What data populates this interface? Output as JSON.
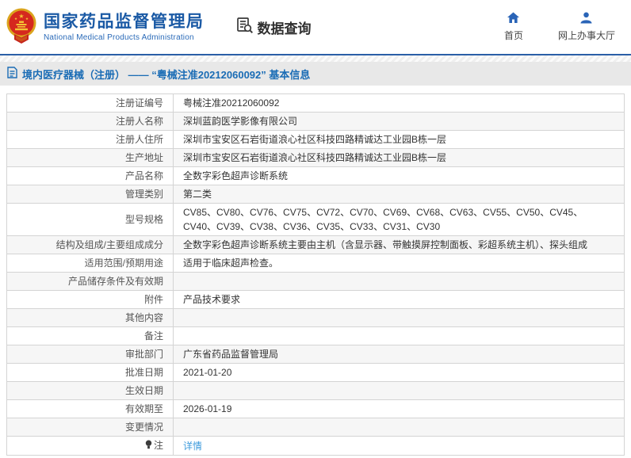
{
  "header": {
    "org_name_cn": "国家药品监督管理局",
    "org_name_en": "National Medical Products Administration",
    "data_query_label": "数据查询",
    "nav": [
      {
        "label": "首页",
        "icon": "home-icon"
      },
      {
        "label": "网上办事大厅",
        "icon": "person-icon"
      }
    ]
  },
  "breadcrumb": {
    "text": "境内医疗器械（注册） —— “粤械注准20212060092” 基本信息"
  },
  "table": {
    "rows": [
      {
        "label": "注册证编号",
        "value": "粤械注准20212060092"
      },
      {
        "label": "注册人名称",
        "value": "深圳蓝韵医学影像有限公司"
      },
      {
        "label": "注册人住所",
        "value": "深圳市宝安区石岩街道浪心社区科技四路精诚达工业园B栋一层"
      },
      {
        "label": "生产地址",
        "value": "深圳市宝安区石岩街道浪心社区科技四路精诚达工业园B栋一层"
      },
      {
        "label": "产品名称",
        "value": "全数字彩色超声诊断系统"
      },
      {
        "label": "管理类别",
        "value": "第二类"
      },
      {
        "label": "型号规格",
        "value": "CV85、CV80、CV76、CV75、CV72、CV70、CV69、CV68、CV63、CV55、CV50、CV45、CV40、CV39、CV38、CV36、CV35、CV33、CV31、CV30"
      },
      {
        "label": "结构及组成/主要组成成分",
        "value": "全数字彩色超声诊断系统主要由主机（含显示器、带触摸屏控制面板、彩超系统主机）、探头组成"
      },
      {
        "label": "适用范围/预期用途",
        "value": "适用于临床超声检查。"
      },
      {
        "label": "产品储存条件及有效期",
        "value": ""
      },
      {
        "label": "附件",
        "value": "产品技术要求"
      },
      {
        "label": "其他内容",
        "value": ""
      },
      {
        "label": "备注",
        "value": ""
      },
      {
        "label": "审批部门",
        "value": "广东省药品监督管理局"
      },
      {
        "label": "批准日期",
        "value": "2021-01-20"
      },
      {
        "label": "生效日期",
        "value": ""
      },
      {
        "label": "有效期至",
        "value": "2026-01-19"
      },
      {
        "label": "变更情况",
        "value": ""
      },
      {
        "label": "注",
        "value": "详情",
        "icon": "note-icon",
        "link": true
      }
    ]
  },
  "colors": {
    "brand_blue": "#1b5aa5",
    "nav_icon_blue": "#2a64b7",
    "separator_blue": "#2b5fa7",
    "breadcrumb_bg": "#e8e8e8",
    "breadcrumb_text": "#1a6cb5",
    "link_blue": "#3d9bdc",
    "emblem_red": "#d5281e",
    "emblem_gold": "#dba41d",
    "row_stripe": "#f6f6f6"
  }
}
